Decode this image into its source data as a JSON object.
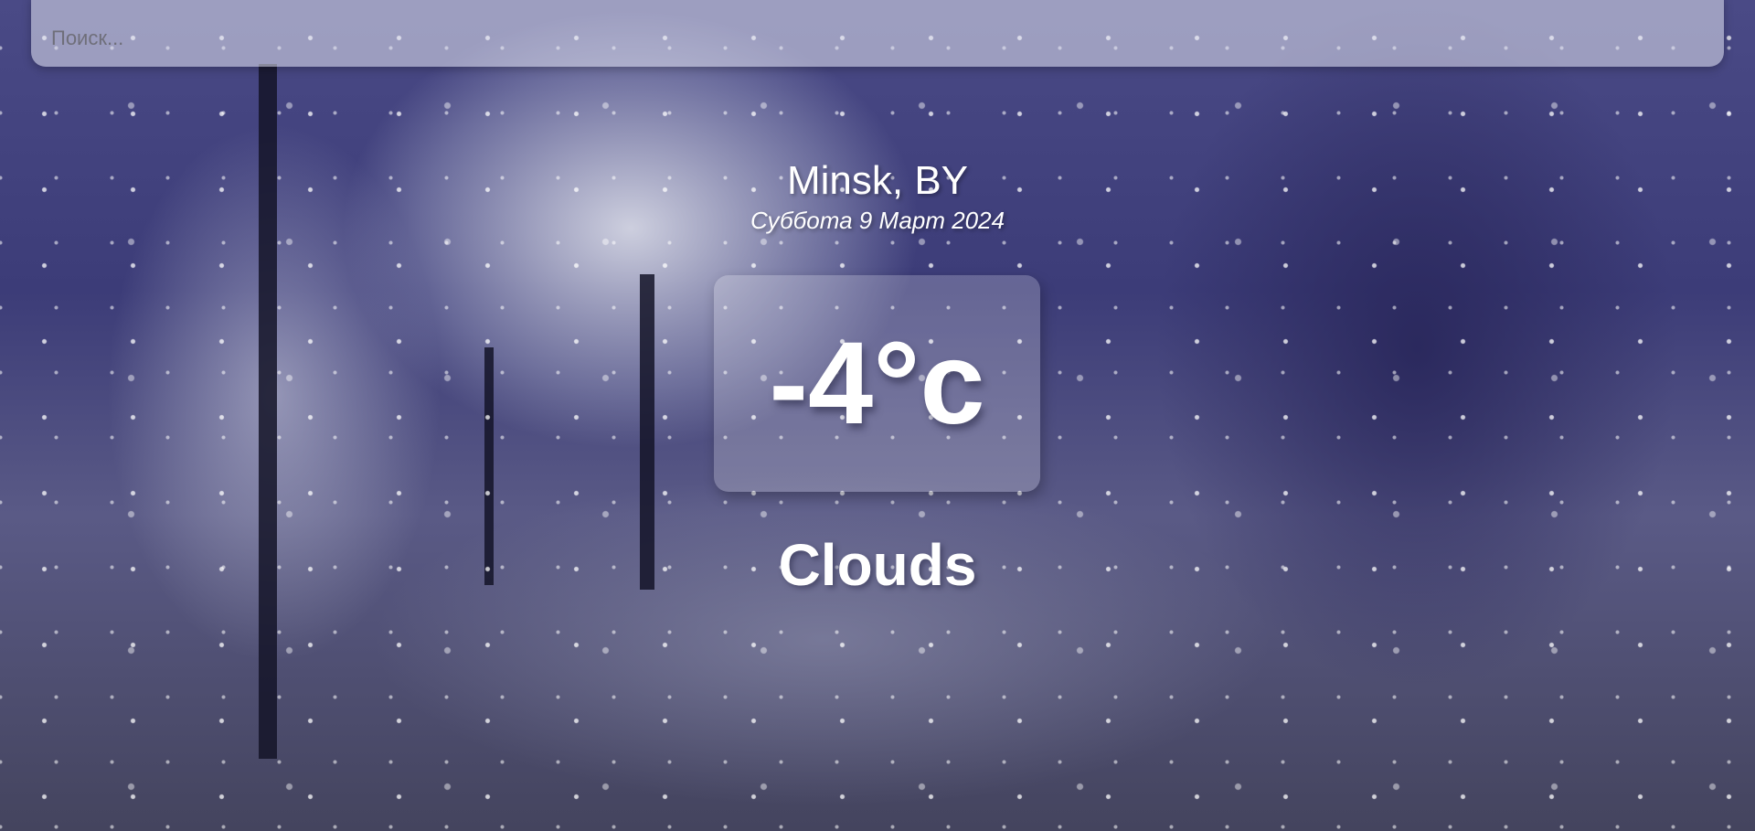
{
  "search": {
    "placeholder": "Поиск...",
    "value": ""
  },
  "location": {
    "city": "Minsk, BY",
    "date": "Суббота 9 Март 2024"
  },
  "current": {
    "temperature": "-4°c",
    "condition": "Clouds"
  },
  "background": {
    "scene": "snowy-night-park",
    "accent": "#3c3c78"
  }
}
